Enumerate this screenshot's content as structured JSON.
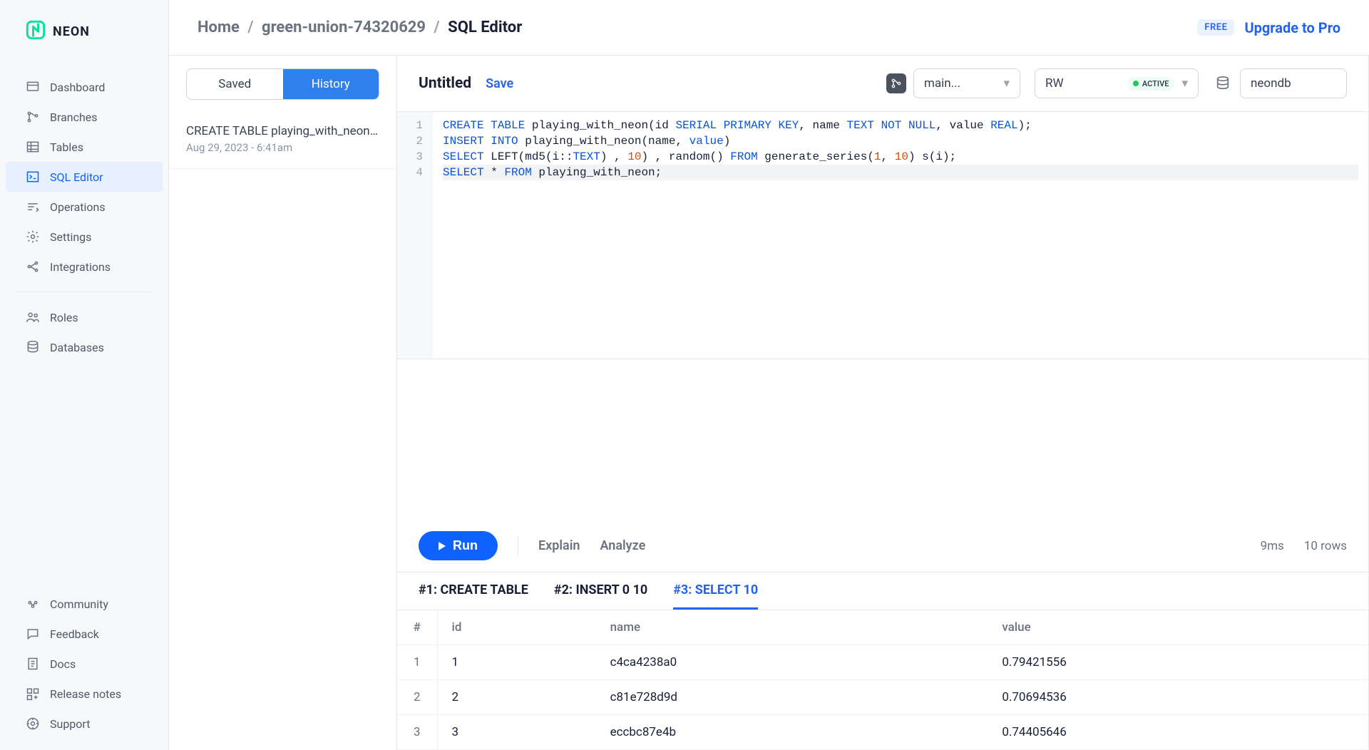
{
  "brand": "NEON",
  "sidebar": {
    "main_items": [
      {
        "label": "Dashboard",
        "icon": "dashboard-icon"
      },
      {
        "label": "Branches",
        "icon": "branch-icon"
      },
      {
        "label": "Tables",
        "icon": "table-icon"
      },
      {
        "label": "SQL Editor",
        "icon": "sql-icon",
        "active": true
      },
      {
        "label": "Operations",
        "icon": "operations-icon"
      },
      {
        "label": "Settings",
        "icon": "gear-icon"
      },
      {
        "label": "Integrations",
        "icon": "integrations-icon"
      }
    ],
    "secondary_items": [
      {
        "label": "Roles",
        "icon": "roles-icon"
      },
      {
        "label": "Databases",
        "icon": "database-icon"
      }
    ],
    "footer_items": [
      {
        "label": "Community",
        "icon": "community-icon"
      },
      {
        "label": "Feedback",
        "icon": "feedback-icon"
      },
      {
        "label": "Docs",
        "icon": "docs-icon"
      },
      {
        "label": "Release notes",
        "icon": "release-icon"
      },
      {
        "label": "Support",
        "icon": "support-icon"
      }
    ]
  },
  "breadcrumbs": {
    "home": "Home",
    "project": "green-union-74320629",
    "current": "SQL Editor"
  },
  "header": {
    "free_badge": "FREE",
    "upgrade": "Upgrade to Pro"
  },
  "history_panel": {
    "tab_saved": "Saved",
    "tab_history": "History",
    "active_tab": "History",
    "items": [
      {
        "title": "CREATE TABLE playing_with_neon...",
        "time": "Aug 29, 2023 - 6:41am"
      }
    ]
  },
  "editor": {
    "doc_name": "Untitled",
    "save_label": "Save",
    "branch_select": "main...",
    "mode_select": "RW",
    "status_label": "ACTIVE",
    "db_select": "neondb",
    "lines": [
      {
        "n": 1,
        "tokens": [
          [
            "kw",
            "CREATE"
          ],
          [
            "",
            " "
          ],
          [
            "kw",
            "TABLE"
          ],
          [
            "",
            " playing_with_neon(id "
          ],
          [
            "kw",
            "SERIAL"
          ],
          [
            "",
            " "
          ],
          [
            "kw",
            "PRIMARY"
          ],
          [
            "",
            " "
          ],
          [
            "kw",
            "KEY"
          ],
          [
            "",
            ", name "
          ],
          [
            "kw",
            "TEXT"
          ],
          [
            "",
            " "
          ],
          [
            "kw",
            "NOT"
          ],
          [
            "",
            " "
          ],
          [
            "kw",
            "NULL"
          ],
          [
            "",
            ", value "
          ],
          [
            "kw",
            "REAL"
          ],
          [
            "",
            ");"
          ]
        ]
      },
      {
        "n": 2,
        "tokens": [
          [
            "kw",
            "INSERT"
          ],
          [
            "",
            " "
          ],
          [
            "kw",
            "INTO"
          ],
          [
            "",
            " playing_with_neon(name, "
          ],
          [
            "kw",
            "value"
          ],
          [
            "",
            ")"
          ]
        ]
      },
      {
        "n": 3,
        "tokens": [
          [
            "kw",
            "SELECT"
          ],
          [
            "",
            " LEFT(md5(i::"
          ],
          [
            "kw",
            "TEXT"
          ],
          [
            "",
            ")"
          ],
          [
            "",
            " , "
          ],
          [
            "num",
            "10"
          ],
          [
            "",
            ")"
          ],
          [
            "",
            " , random() "
          ],
          [
            "kw",
            "FROM"
          ],
          [
            "",
            " generate_series("
          ],
          [
            "num",
            "1"
          ],
          [
            "",
            ", "
          ],
          [
            "num",
            "10"
          ],
          [
            "",
            ") s(i);"
          ]
        ]
      },
      {
        "n": 4,
        "hl": true,
        "tokens": [
          [
            "kw",
            "SELECT"
          ],
          [
            "",
            " * "
          ],
          [
            "kw",
            "FROM"
          ],
          [
            "",
            " playing_with_neon;"
          ]
        ]
      }
    ]
  },
  "runbar": {
    "run": "Run",
    "explain": "Explain",
    "analyze": "Analyze",
    "time_ms": "9ms",
    "rows": "10 rows"
  },
  "result_tabs": [
    {
      "label": "#1: CREATE TABLE",
      "active": false
    },
    {
      "label": "#2: INSERT 0 10",
      "active": false
    },
    {
      "label": "#3: SELECT 10",
      "active": true
    }
  ],
  "result": {
    "columns": [
      "#",
      "id",
      "name",
      "value"
    ],
    "rows": [
      [
        "1",
        "1",
        "c4ca4238a0",
        "0.79421556"
      ],
      [
        "2",
        "2",
        "c81e728d9d",
        "0.70694536"
      ],
      [
        "3",
        "3",
        "eccbc87e4b",
        "0.74405646"
      ]
    ]
  }
}
